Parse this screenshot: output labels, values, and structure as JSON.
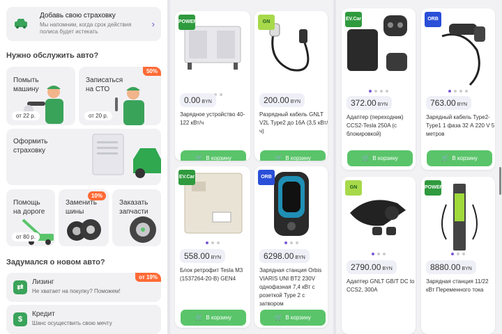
{
  "insurance": {
    "title": "Добавь свою страховку",
    "subtitle": "Мы напомним, когда срок действия полиса будет истекать"
  },
  "service_section": {
    "title": "Нужно обслужить авто?"
  },
  "services": {
    "wash": {
      "label_line1": "Помыть",
      "label_line2": "машину",
      "price": "от 22 р."
    },
    "sto": {
      "label_line1": "Записаться",
      "label_line2": "на СТО",
      "price": "от 20 р.",
      "badge": "50%"
    },
    "insure": {
      "label_line1": "Оформить",
      "label_line2": "страховку"
    },
    "help": {
      "label_line1": "Помощь",
      "label_line2": "на дороге",
      "price": "от 80 р."
    },
    "tires": {
      "label_line1": "Заменить",
      "label_line2": "шины",
      "badge": "10%"
    },
    "parts": {
      "label_line1": "Заказать",
      "label_line2": "запчасти"
    }
  },
  "newcar_section": {
    "title": "Задумался о новом авто?"
  },
  "lease": {
    "title": "Лизинг",
    "subtitle": "Не хватает на покупку? Поможем!",
    "badge": "от 19%"
  },
  "credit": {
    "title": "Кредит",
    "subtitle": "Шанс осуществить свою мечту"
  },
  "colors": {
    "accent": "#6a4fd4",
    "green": "#5ac46a",
    "badge": "#ff6a35"
  },
  "products": [
    {
      "price": "0.00",
      "currency": "BYN",
      "name": "Зарядное устройство 40-122 кВт/ч",
      "button": "В корзину",
      "logo": "POWER"
    },
    {
      "price": "200.00",
      "currency": "BYN",
      "name": "Разрядный кабель GNLT V2L Type2 до 16А (3,5 кВт/ч)",
      "button": "В корзину",
      "logo": "GN"
    },
    {
      "price": "372.00",
      "currency": "BYN",
      "name": "Адаптер (переходник) CCS2-Tesla 250A (с блокировкой)",
      "button": "В корзину",
      "logo": "EV.Car"
    },
    {
      "price": "763.00",
      "currency": "BYN",
      "name": "Зарядный кабель Type2-Type1 1 фаза 32 А 220 V 5 метров",
      "button": "В корзину",
      "logo": "ORB"
    },
    {
      "price": "558.00",
      "currency": "BYN",
      "name": "Блок ретрофит Tesla M3 (1537264-20-B) GEN4",
      "button": "В корзину",
      "logo": "EV.Car"
    },
    {
      "price": "6298.00",
      "currency": "BYN",
      "name": "Зарядная станция Orbis VIARIS UNI BT2 230V однофазная 7,4 кВт с розеткой Type 2 с затвором",
      "button": "В корзину",
      "logo": "ORB"
    },
    {
      "price": "2790.00",
      "currency": "BYN",
      "name": "Адаптер GNLT GB/T DC to CCS2, 300A",
      "button": "В корзину",
      "logo": "GN"
    },
    {
      "price": "8880.00",
      "currency": "BYN",
      "name": "Зарядная станция 11/22 кВт Переменного тока",
      "button": "В корзину",
      "logo": "POWER"
    }
  ]
}
